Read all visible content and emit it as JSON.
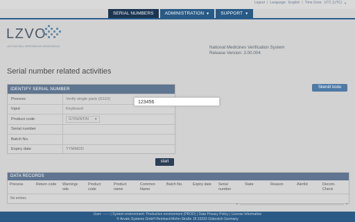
{
  "toplinks": {
    "logout": "Logout",
    "language_label": "Language:",
    "language_value": "English",
    "timezone_label": "Time Zone:",
    "timezone_value": "UTC (UTC)"
  },
  "nav": {
    "serial_numbers": "SERIAL NUMBERS",
    "administration": "ADMINISTRATION",
    "support": "SUPPORT",
    "caret": "▼"
  },
  "logo": {
    "text": "LZVO",
    "subtitle": "LATVIJAS ZĀĻU VERIFIKĀCIJAS ORGANIZĀCIJA"
  },
  "system": {
    "name": "National Medicines Verification System",
    "release": "Release Version: 3.00.004"
  },
  "page_title": "Serial number related activities",
  "identify": {
    "header": "IDENTIFY SERIAL NUMBER",
    "rows": [
      {
        "label": "Process",
        "value": "Verify single pack (G110)"
      },
      {
        "label": "Input",
        "value": "Keyboard"
      },
      {
        "label": "Product code",
        "value": "GTIN/NTIN"
      },
      {
        "label": "Serial number",
        "value": ""
      },
      {
        "label": "Batch No.",
        "value": ""
      },
      {
        "label": "Expiry date",
        "value": "YYMMDD"
      }
    ],
    "serial_value": "123456",
    "start_label": "start"
  },
  "skenet_label": "Skenēt kodu",
  "records": {
    "header": "DATA RECORDS",
    "columns": [
      "Process",
      "Return code",
      "Warningc ode",
      "Product code",
      "Product name",
      "Common Name",
      "Batch No.",
      "Expiry date",
      "Serial number",
      "State",
      "Reason",
      "AlertId",
      "Decom. Check"
    ],
    "empty_text": "No entries"
  },
  "footer": {
    "line1": "User: ------ | System environment: Production environment (PROD) | Data Privacy Policy | License Information",
    "line2": "© Arvato Systems GmbH Reinhard-Mohn-Straße 18 33333 Gütersloh Germany"
  },
  "colors": {
    "nav_tab": "#285a86",
    "nav_active": "#1b3552",
    "panel_header": "#5f7590",
    "footer": "#2b5a86",
    "skenet_button": "#4d7aa6",
    "start_button": "#2b3f56"
  }
}
